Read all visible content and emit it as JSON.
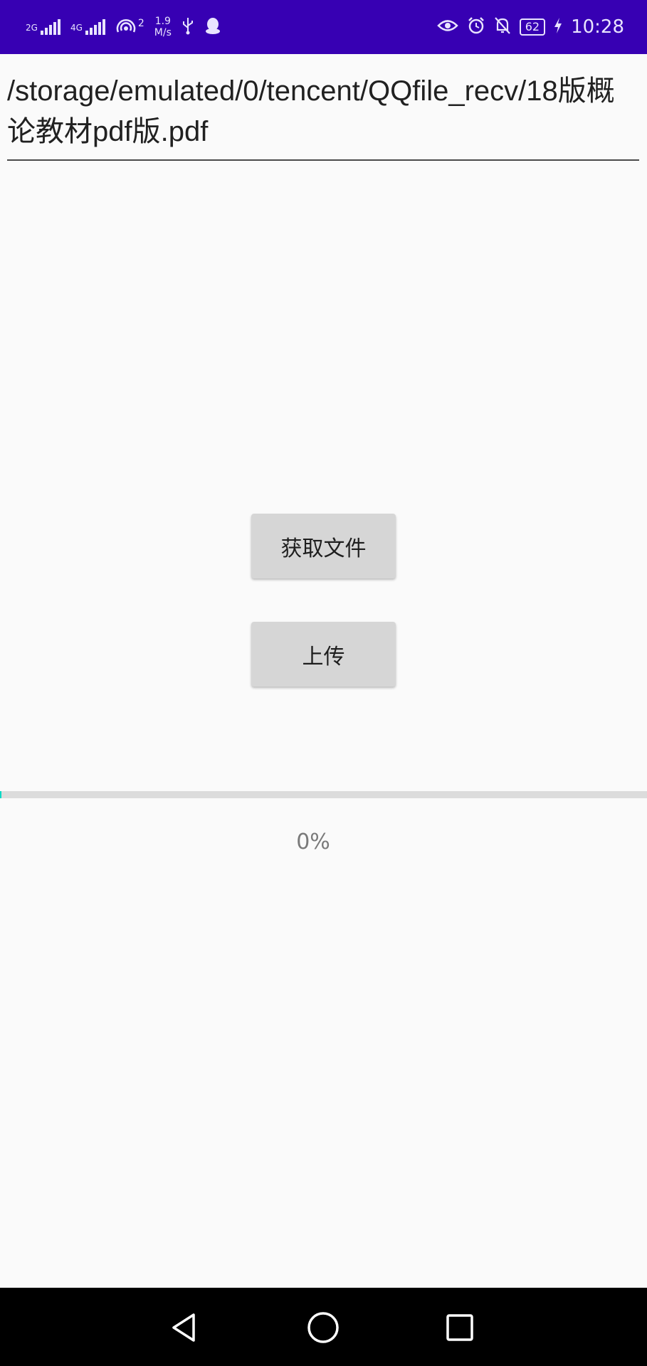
{
  "status_bar": {
    "signal1_label": "2G",
    "signal2_label": "4G",
    "hotspot_count": "2",
    "net_speed_value": "1.9",
    "net_speed_unit": "M/s",
    "battery": "62",
    "time": "10:28"
  },
  "file_path": {
    "value": "/storage/emulated/0/tencent/QQfile_recv/18版概论教材pdf版.pdf"
  },
  "buttons": {
    "get_file": "获取文件",
    "upload": "上传"
  },
  "progress": {
    "fraction": 0,
    "label": "0%"
  },
  "colors": {
    "status_bar": "#3700b3",
    "progress_accent": "#03dac5"
  }
}
